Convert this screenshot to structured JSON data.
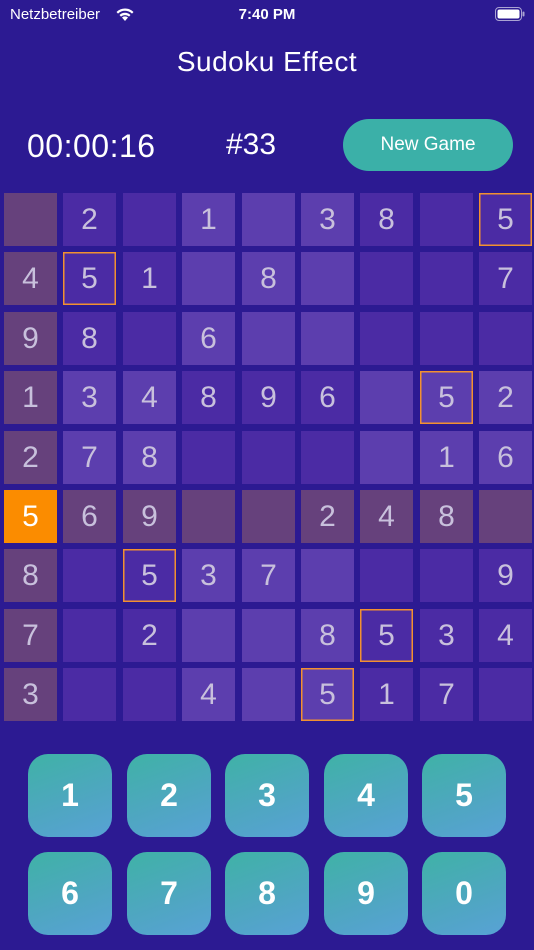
{
  "status_bar": {
    "carrier": "Netzbetreiber",
    "time": "7:40 PM",
    "wifi_icon": "wifi-icon",
    "battery_icon": "battery-icon"
  },
  "title": "Sudoku Effect",
  "timer": "00:00:16",
  "game_number": "#33",
  "new_game_label": "New Game",
  "colors": {
    "background": "#2c1a92",
    "cell_light": "#5c3eae",
    "cell_dark": "#4b2ba4",
    "cell_muted": "#603f9a",
    "conflict": "#66417c",
    "selected": "#fb8c00",
    "outline": "#f29030",
    "key_gradient_start": "#3fb2a6",
    "key_gradient_end": "#58a2d6",
    "button": "#3bb0a8"
  },
  "board": {
    "cells": [
      [
        "",
        "2",
        "",
        "1",
        "",
        "3",
        "8",
        "",
        "5"
      ],
      [
        "4",
        "5",
        "1",
        "",
        "8",
        "",
        "",
        "",
        "7"
      ],
      [
        "9",
        "8",
        "",
        "6",
        "",
        "",
        "",
        "",
        ""
      ],
      [
        "1",
        "3",
        "4",
        "8",
        "9",
        "6",
        "",
        "5",
        "2"
      ],
      [
        "2",
        "7",
        "8",
        "",
        "",
        "",
        "",
        "1",
        "6"
      ],
      [
        "5",
        "6",
        "9",
        "",
        "",
        "2",
        "4",
        "8",
        ""
      ],
      [
        "8",
        "",
        "5",
        "3",
        "7",
        "",
        "",
        "",
        "9"
      ],
      [
        "7",
        "",
        "2",
        "",
        "",
        "8",
        "5",
        "3",
        "4"
      ],
      [
        "3",
        "",
        "",
        "4",
        "",
        "5",
        "1",
        "7",
        ""
      ]
    ],
    "tones": [
      [
        "c",
        "b",
        "b",
        "a",
        "a",
        "a",
        "b",
        "b",
        "b"
      ],
      [
        "c",
        "b",
        "b",
        "a",
        "a",
        "a",
        "b",
        "b",
        "b"
      ],
      [
        "c",
        "b",
        "b",
        "a",
        "a",
        "a",
        "b",
        "b",
        "b"
      ],
      [
        "c",
        "a",
        "a",
        "b",
        "b",
        "b",
        "a",
        "a",
        "a"
      ],
      [
        "c",
        "a",
        "a",
        "b",
        "b",
        "b",
        "a",
        "a",
        "a"
      ],
      [
        "s",
        "c",
        "c",
        "c",
        "c",
        "c",
        "c",
        "c",
        "c"
      ],
      [
        "c",
        "b",
        "b",
        "a",
        "a",
        "a",
        "b",
        "b",
        "b"
      ],
      [
        "c",
        "b",
        "b",
        "a",
        "a",
        "a",
        "b",
        "b",
        "b"
      ],
      [
        "c",
        "b",
        "b",
        "a",
        "a",
        "a",
        "b",
        "b",
        "b"
      ]
    ],
    "outlined": [
      [
        0,
        8
      ],
      [
        1,
        1
      ],
      [
        3,
        7
      ],
      [
        6,
        2
      ],
      [
        7,
        6
      ],
      [
        8,
        5
      ]
    ]
  },
  "keypad": [
    "1",
    "2",
    "3",
    "4",
    "5",
    "6",
    "7",
    "8",
    "9",
    "0"
  ]
}
